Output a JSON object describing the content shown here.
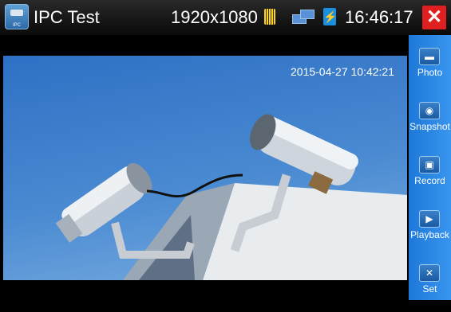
{
  "header": {
    "title": "IPC Test",
    "app_icon_label": "IPC",
    "resolution": "1920x1080",
    "time": "16:46:17",
    "close_symbol": "✕"
  },
  "video": {
    "timestamp": "2015-04-27 10:42:21"
  },
  "sidebar": {
    "items": [
      {
        "label": "Photo",
        "icon": "photo-icon"
      },
      {
        "label": "Snapshot",
        "icon": "camera-icon"
      },
      {
        "label": "Record",
        "icon": "record-icon"
      },
      {
        "label": "Playback",
        "icon": "playback-icon"
      },
      {
        "label": "Set",
        "icon": "settings-icon"
      }
    ]
  },
  "colors": {
    "close": "#e02020",
    "sidebar": "#2a86e6",
    "sd_card": "#ffd21a",
    "battery": "#1a8fe0"
  }
}
